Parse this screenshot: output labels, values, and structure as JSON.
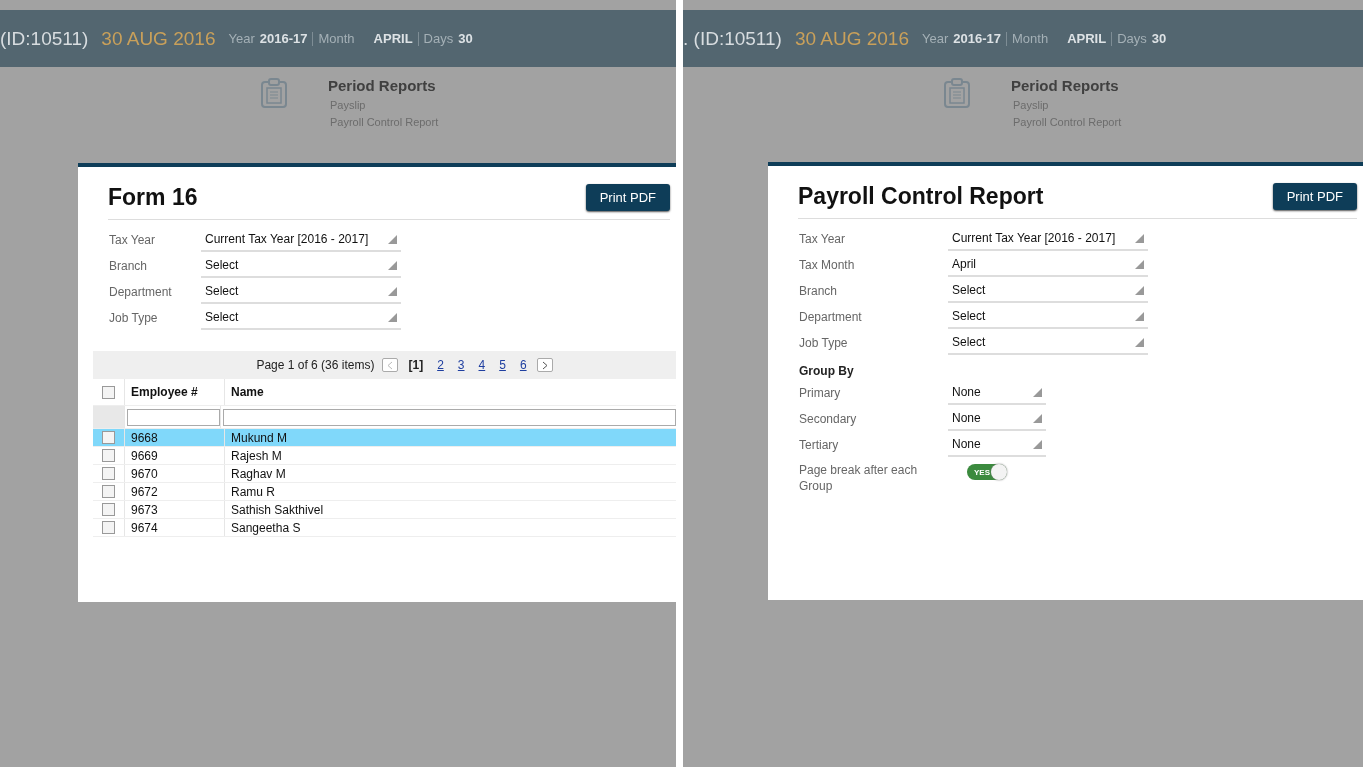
{
  "panels": [
    {
      "header": {
        "id_text": "(ID:10511)",
        "date": "30 AUG 2016",
        "year_label": "Year",
        "year": "2016-17",
        "month_label": "Month",
        "month": "APRIL",
        "days_label": "Days",
        "days": "30"
      },
      "menu": {
        "title": "Period Reports",
        "items": [
          "Payslip",
          "Payroll Control Report"
        ]
      },
      "dialog": {
        "title": "Form 16",
        "button": "Print PDF",
        "fields": [
          {
            "label": "Tax Year",
            "value": "Current Tax Year [2016 - 2017]"
          },
          {
            "label": "Branch",
            "value": "Select"
          },
          {
            "label": "Department",
            "value": "Select"
          },
          {
            "label": "Job Type",
            "value": "Select"
          }
        ],
        "grid": {
          "pager_text": "Page 1 of 6 (36 items)",
          "pages": [
            {
              "label": "[1]",
              "selected": true
            },
            {
              "label": "2",
              "selected": false
            },
            {
              "label": "3",
              "selected": false
            },
            {
              "label": "4",
              "selected": false
            },
            {
              "label": "5",
              "selected": false
            },
            {
              "label": "6",
              "selected": false
            }
          ],
          "all_checked": false,
          "columns": [
            "Employee #",
            "Name"
          ],
          "rows": [
            {
              "id": "9668",
              "name": "Mukund M",
              "selected": true,
              "checked": false
            },
            {
              "id": "9669",
              "name": "Rajesh M",
              "selected": false,
              "checked": false
            },
            {
              "id": "9670",
              "name": "Raghav M",
              "selected": false,
              "checked": false
            },
            {
              "id": "9672",
              "name": "Ramu R",
              "selected": false,
              "checked": false
            },
            {
              "id": "9673",
              "name": "Sathish Sakthivel",
              "selected": false,
              "checked": false
            },
            {
              "id": "9674",
              "name": "Sangeetha S",
              "selected": false,
              "checked": false
            }
          ]
        }
      }
    },
    {
      "header": {
        "id_text": ". (ID:10511)",
        "date": "30 AUG 2016",
        "year_label": "Year",
        "year": "2016-17",
        "month_label": "Month",
        "month": "APRIL",
        "days_label": "Days",
        "days": "30"
      },
      "menu": {
        "title": "Period Reports",
        "items": [
          "Payslip",
          "Payroll Control Report"
        ]
      },
      "dialog": {
        "title": "Payroll Control Report",
        "button": "Print PDF",
        "fields": [
          {
            "label": "Tax Year",
            "value": "Current Tax Year [2016 - 2017]"
          },
          {
            "label": "Tax Month",
            "value": "April"
          },
          {
            "label": "Branch",
            "value": "Select"
          },
          {
            "label": "Department",
            "value": "Select"
          },
          {
            "label": "Job Type",
            "value": "Select"
          }
        ],
        "group": {
          "title": "Group By",
          "fields": [
            {
              "label": "Primary",
              "value": "None"
            },
            {
              "label": "Secondary",
              "value": "None"
            },
            {
              "label": "Tertiary",
              "value": "None"
            }
          ]
        },
        "toggle": {
          "label": "Page break after each Group",
          "on": true,
          "text": "YES"
        }
      }
    }
  ]
}
